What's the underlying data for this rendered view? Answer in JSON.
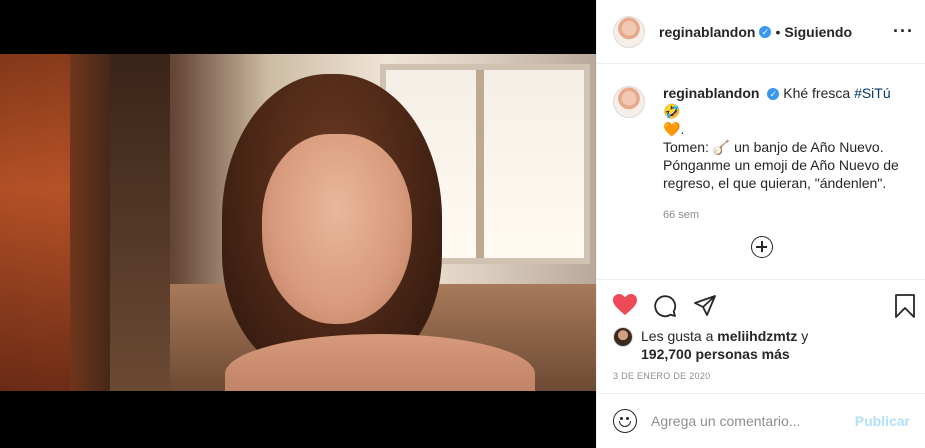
{
  "post": {
    "username": "reginablandon",
    "verified_glyph": "✓",
    "dot": "•",
    "follow_status": "Siguiendo",
    "more_glyph": "···"
  },
  "caption": {
    "username": "reginablandon",
    "text_part1": "Khé fresca",
    "hashtag": "#SiTú",
    "emoji1": "🤣",
    "emoji2": "🧡",
    "line2_prefix": "Tomen:",
    "line2_suffix": "un banjo de Año Nuevo.",
    "banjo_emoji": "🪕",
    "line3": "Pónganme un emoji de Año Nuevo de regreso, el que quieran, \"ándenlen\".",
    "time_ago": "66 sem"
  },
  "icons": {
    "add_comment": "add-circle-icon",
    "like": "heart-icon",
    "comment": "comment-icon",
    "share": "send-icon",
    "save": "bookmark-icon",
    "emoji": "smile-icon"
  },
  "likes": {
    "prefix": "Les gusta a",
    "liker": "meliihdzmtz",
    "connector": "y",
    "count_text": "192,700 personas más"
  },
  "date": "3 DE ENERO DE 2020",
  "comment_box": {
    "placeholder": "Agrega un comentario...",
    "publish_label": "Publicar"
  },
  "colors": {
    "like_red": "#ed4956",
    "publish_disabled": "#b2dffc",
    "verified_blue": "#3897f0"
  }
}
